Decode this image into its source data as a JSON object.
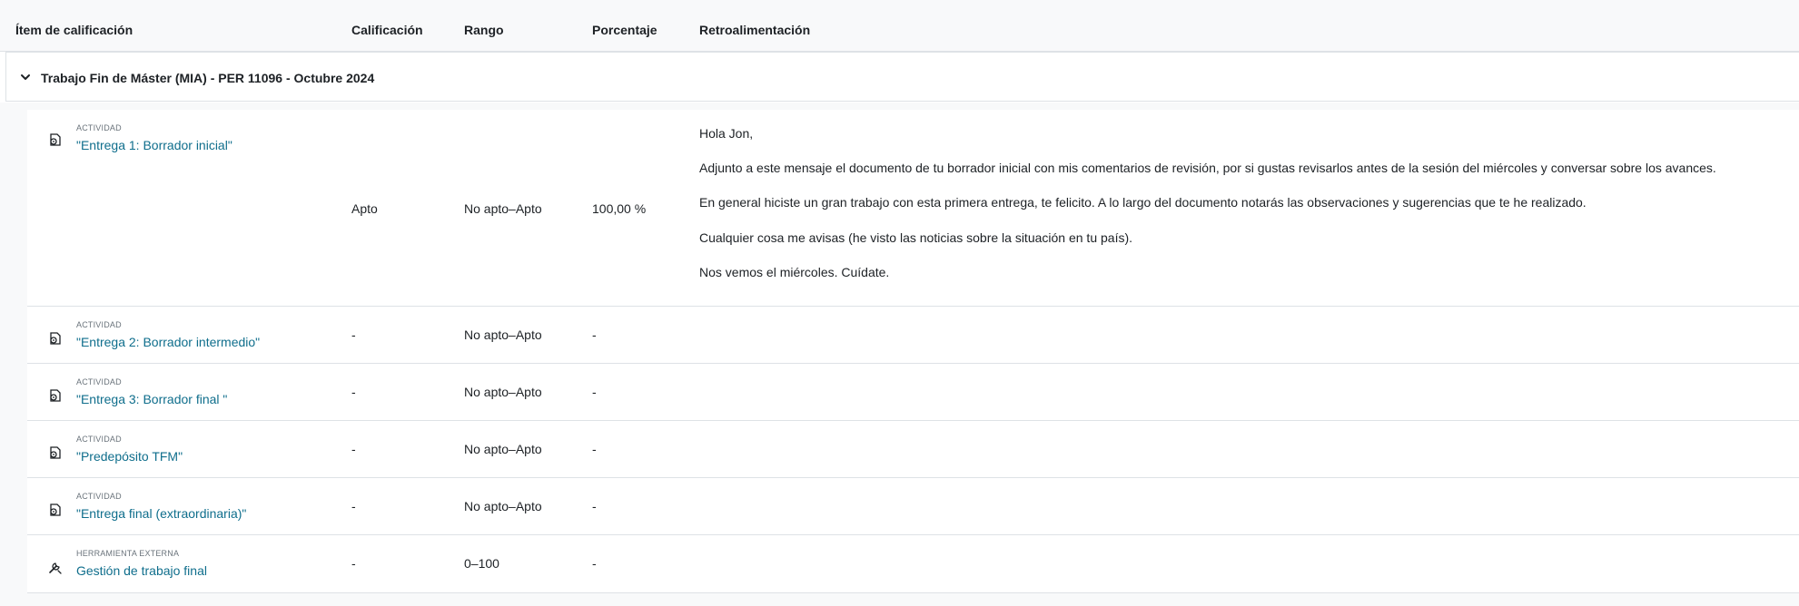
{
  "table": {
    "headers": {
      "item": "Ítem de calificación",
      "grade": "Calificación",
      "range": "Rango",
      "percentage": "Porcentaje",
      "feedback": "Retroalimentación"
    },
    "category": {
      "name": "Trabajo Fin de Máster (MIA) - PER 11096 - Octubre 2024"
    },
    "items": [
      {
        "type": "ACTIVIDAD",
        "name": "\"Entrega 1: Borrador inicial\"",
        "icon": "assignment-icon",
        "grade": "Apto",
        "range": "No apto–Apto",
        "percentage": "100,00 %",
        "feedback": [
          "Hola Jon,",
          "Adjunto a este mensaje el documento de tu borrador inicial con mis comentarios de revisión, por si gustas revisarlos antes de la sesión del miércoles y conversar sobre los avances.",
          "En general hiciste un gran trabajo con esta primera entrega, te felicito. A lo largo del documento notarás las observaciones y sugerencias que te he realizado.",
          "Cualquier cosa me avisas (he visto las noticias sobre la situación en tu país).",
          "Nos vemos el miércoles. Cuídate."
        ]
      },
      {
        "type": "ACTIVIDAD",
        "name": "\"Entrega 2: Borrador intermedio\"",
        "icon": "assignment-icon",
        "grade": "-",
        "range": "No apto–Apto",
        "percentage": "-"
      },
      {
        "type": "ACTIVIDAD",
        "name": "\"Entrega 3: Borrador final \"",
        "icon": "assignment-icon",
        "grade": "-",
        "range": "No apto–Apto",
        "percentage": "-"
      },
      {
        "type": "ACTIVIDAD",
        "name": "\"Predepósito TFM\"",
        "icon": "assignment-icon",
        "grade": "-",
        "range": "No apto–Apto",
        "percentage": "-"
      },
      {
        "type": "ACTIVIDAD",
        "name": "\"Entrega final (extraordinaria)\"",
        "icon": "assignment-icon",
        "grade": "-",
        "range": "No apto–Apto",
        "percentage": "-"
      },
      {
        "type": "HERRAMIENTA EXTERNA",
        "name": "Gestión de trabajo final",
        "icon": "external-tool-icon",
        "grade": "-",
        "range": "0–100",
        "percentage": "-"
      }
    ]
  },
  "colors": {
    "link": "#0f6e8c",
    "header_bg": "#f8f9fa",
    "border": "#dee2e6",
    "muted": "#6a737b"
  }
}
